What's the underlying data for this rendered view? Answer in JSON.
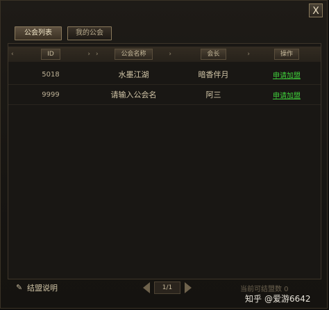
{
  "window": {
    "close_label": "X"
  },
  "tabs": [
    {
      "label": "公会列表",
      "active": true
    },
    {
      "label": "我的公会",
      "active": false
    }
  ],
  "table": {
    "headers": [
      "ID",
      "公会名称",
      "会长",
      "操作"
    ],
    "rows": [
      {
        "id": "5018",
        "name": "水墨江湖",
        "leader": "暗香伴月",
        "action": "申请加盟"
      },
      {
        "id": "9999",
        "name": "请输入公会名",
        "leader": "阿三",
        "action": "申请加盟"
      }
    ]
  },
  "footer": {
    "help_label": "结盟说明",
    "page": "1/1",
    "note": "当前可结盟数 0"
  },
  "watermark": {
    "brand": "知乎",
    "handle": "@爱游6642"
  },
  "colors": {
    "accent_green": "#3fcf3a"
  }
}
